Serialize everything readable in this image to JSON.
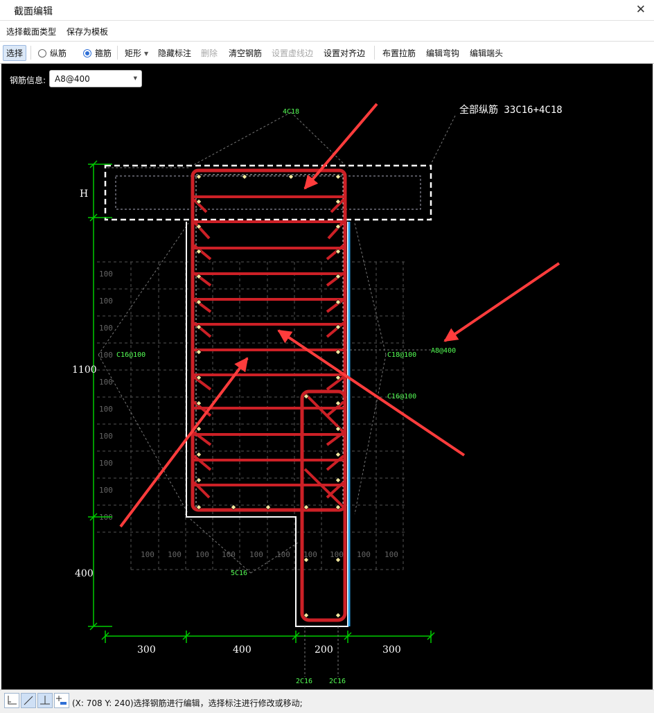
{
  "window": {
    "title": "截面编辑",
    "close_glyph": "✕"
  },
  "menu": {
    "items": [
      "选择截面类型",
      "保存为模板"
    ]
  },
  "toolbar": {
    "select": "选择",
    "radio_longitudinal": "纵筋",
    "radio_stirrup": "箍筋",
    "shape": "矩形",
    "hide_dims": "隐藏标注",
    "delete": "删除",
    "clear_rebar": "清空钢筋",
    "set_dashed_edge": "设置虚线边",
    "set_align_edge": "设置对齐边",
    "place_tie": "布置拉筋",
    "edit_hook": "编辑弯钩",
    "edit_end": "编辑端头",
    "selected_radio": "箍筋"
  },
  "rebar_info": {
    "label": "钢筋信息:",
    "value": "A8@400"
  },
  "drawing": {
    "total_label": "全部纵筋 33C16+4C18",
    "callouts": {
      "top": "4C18",
      "left": "C16@100",
      "right1": "C18@100",
      "right2": "C16@100",
      "bottom": "5C16",
      "stirrup": "A8@400",
      "bottom_left": "2C16",
      "bottom_right": "2C16"
    },
    "dims": {
      "h_label": "H",
      "left_1100": "1100",
      "left_400": "400",
      "bottom": [
        "300",
        "400",
        "200",
        "300"
      ]
    },
    "grid_label": "100",
    "colors": {
      "background": "#000000",
      "stirrup": "#cc2026",
      "outline": "#ffffff",
      "dim": "#00cc00",
      "annotation": "#55ff55",
      "edge_blue": "#2aa0e6",
      "arrow": "#ff3c3c"
    }
  },
  "status": {
    "text": "(X: 708 Y: 240)选择钢筋进行编辑，选择标注进行修改或移动;",
    "buttons": [
      "orthogonal-icon",
      "line-icon",
      "perpendicular-icon",
      "add-point-icon"
    ]
  }
}
